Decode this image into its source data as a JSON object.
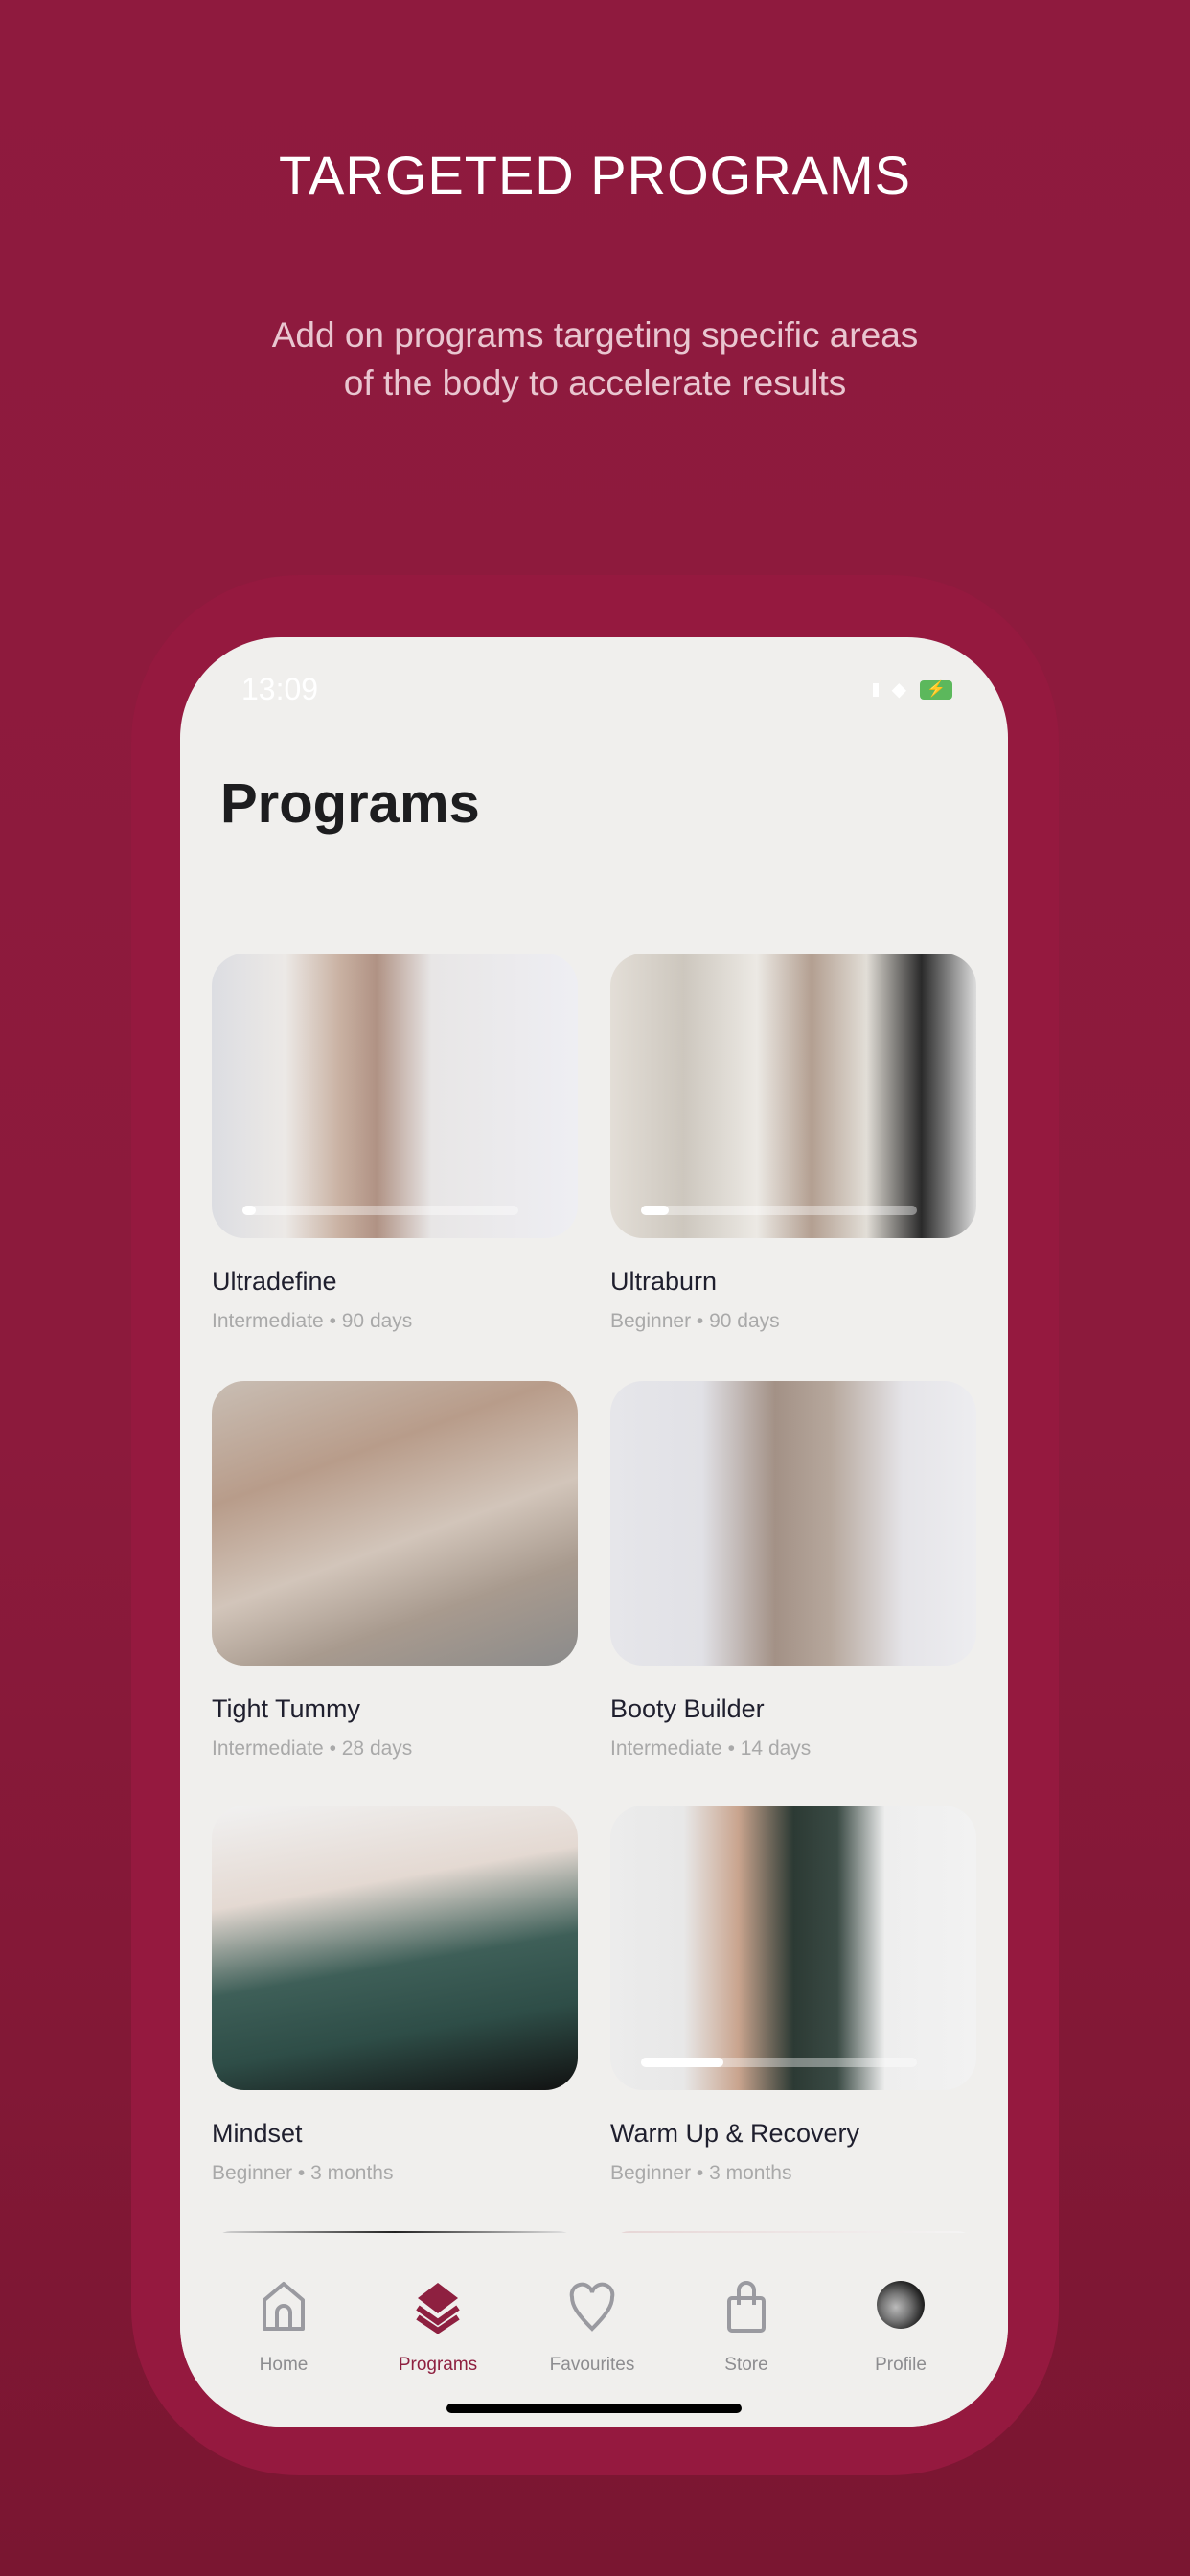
{
  "promo": {
    "headline": "TARGETED PROGRAMS",
    "subtitle_line1": "Add on programs targeting specific areas",
    "subtitle_line2": "of the body to accelerate results"
  },
  "status_bar": {
    "time": "13:09"
  },
  "page_title": "Programs",
  "programs": [
    {
      "title": "Ultradefine",
      "meta": "Intermediate • 90 days",
      "progress": 0.05
    },
    {
      "title": "Ultraburn",
      "meta": "Beginner • 90 days",
      "progress": 0.1
    },
    {
      "title": "Tight Tummy",
      "meta": "Intermediate • 28 days"
    },
    {
      "title": "Booty Builder",
      "meta": "Intermediate • 14 days"
    },
    {
      "title": "Mindset",
      "meta": "Beginner • 3 months"
    },
    {
      "title": "Warm Up & Recovery",
      "meta": "Beginner • 3 months",
      "progress": 0.3
    }
  ],
  "tabs": [
    {
      "label": "Home",
      "icon": "home-icon"
    },
    {
      "label": "Programs",
      "icon": "layers-icon",
      "active": true
    },
    {
      "label": "Favourites",
      "icon": "heart-icon"
    },
    {
      "label": "Store",
      "icon": "shopping-bag-icon"
    },
    {
      "label": "Profile",
      "icon": "avatar"
    }
  ],
  "colors": {
    "brand": "#8e1a3d",
    "active_tab": "#8e2040",
    "inactive_tab": "#9a9aa0"
  }
}
